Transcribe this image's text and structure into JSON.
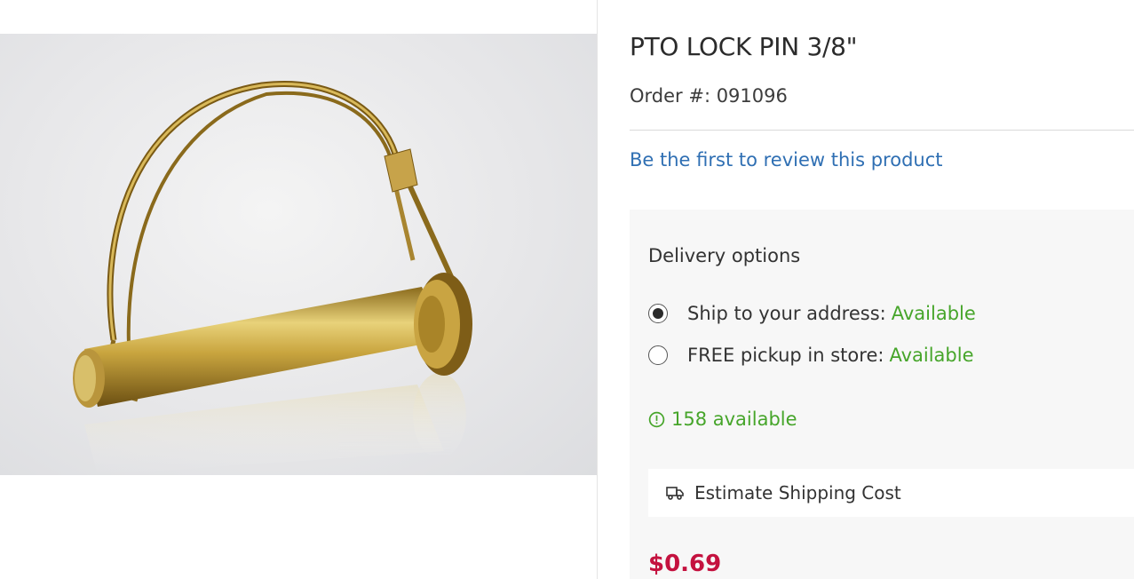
{
  "product": {
    "title": "PTO LOCK PIN 3/8\"",
    "order_label": "Order #: 091096",
    "review_link": "Be the first to review this product",
    "image_icon": "lock-pin-photo"
  },
  "delivery": {
    "title": "Delivery options",
    "options": [
      {
        "label": "Ship to your address:",
        "status": "Available",
        "selected": true
      },
      {
        "label": "FREE pickup in store:",
        "status": "Available",
        "selected": false
      }
    ],
    "stock_text": "158 available",
    "stock_icon": "alert-circle-icon",
    "shipping_cost_label": "Estimate Shipping Cost",
    "shipping_icon": "truck-icon"
  },
  "price": "$0.69",
  "colors": {
    "link": "#2f6fb3",
    "available": "#46a52a",
    "price": "#c4123f",
    "panel_bg": "#f7f7f7"
  }
}
